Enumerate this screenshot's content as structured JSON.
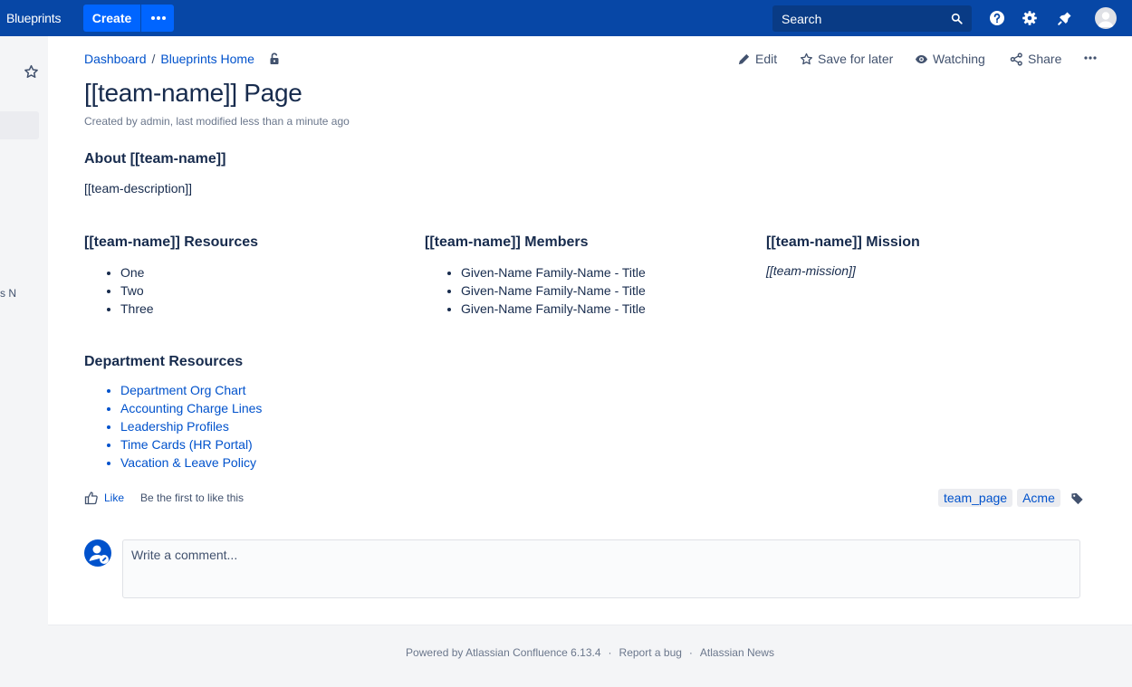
{
  "topbar": {
    "brand": "Blueprints",
    "create_label": "Create",
    "search_label": "Search",
    "icons": [
      "help-icon",
      "settings-icon",
      "notifications-icon",
      "avatar"
    ]
  },
  "sidebar": {
    "fragment_text": "s N"
  },
  "breadcrumb": {
    "items": [
      "Dashboard",
      "Blueprints Home"
    ],
    "separator": "/"
  },
  "actions": {
    "edit": "Edit",
    "save_for_later": "Save for later",
    "watching": "Watching",
    "share": "Share"
  },
  "page": {
    "title": "[[team-name]] Page",
    "meta": "Created by admin, last modified less than a minute ago"
  },
  "about": {
    "heading": "About [[team-name]]",
    "text": "[[team-description]]"
  },
  "columns": {
    "resources": {
      "heading": "[[team-name]] Resources",
      "items": [
        "One",
        "Two",
        "Three"
      ]
    },
    "members": {
      "heading": "[[team-name]] Members",
      "items": [
        "Given-Name Family-Name - Title",
        "Given-Name Family-Name - Title",
        "Given-Name Family-Name - Title"
      ]
    },
    "mission": {
      "heading": "[[team-name]] Mission",
      "text": "[[team-mission]]"
    }
  },
  "department": {
    "heading": "Department Resources",
    "links": [
      "Department Org Chart",
      "Accounting Charge Lines",
      "Leadership Profiles",
      "Time Cards (HR Portal)",
      "Vacation & Leave Policy"
    ]
  },
  "likes": {
    "like_label": "Like",
    "note": "Be the first to like this"
  },
  "labels": [
    "team_page",
    "Acme"
  ],
  "comment": {
    "placeholder": "Write a comment..."
  },
  "footer": {
    "powered": "Powered by Atlassian Confluence 6.13.4",
    "report": "Report a bug",
    "news": "Atlassian News",
    "sep": "·"
  },
  "colors": {
    "topbar": "#0747a6",
    "create": "#0065ff",
    "link": "#0052cc",
    "text": "#172b4d"
  }
}
